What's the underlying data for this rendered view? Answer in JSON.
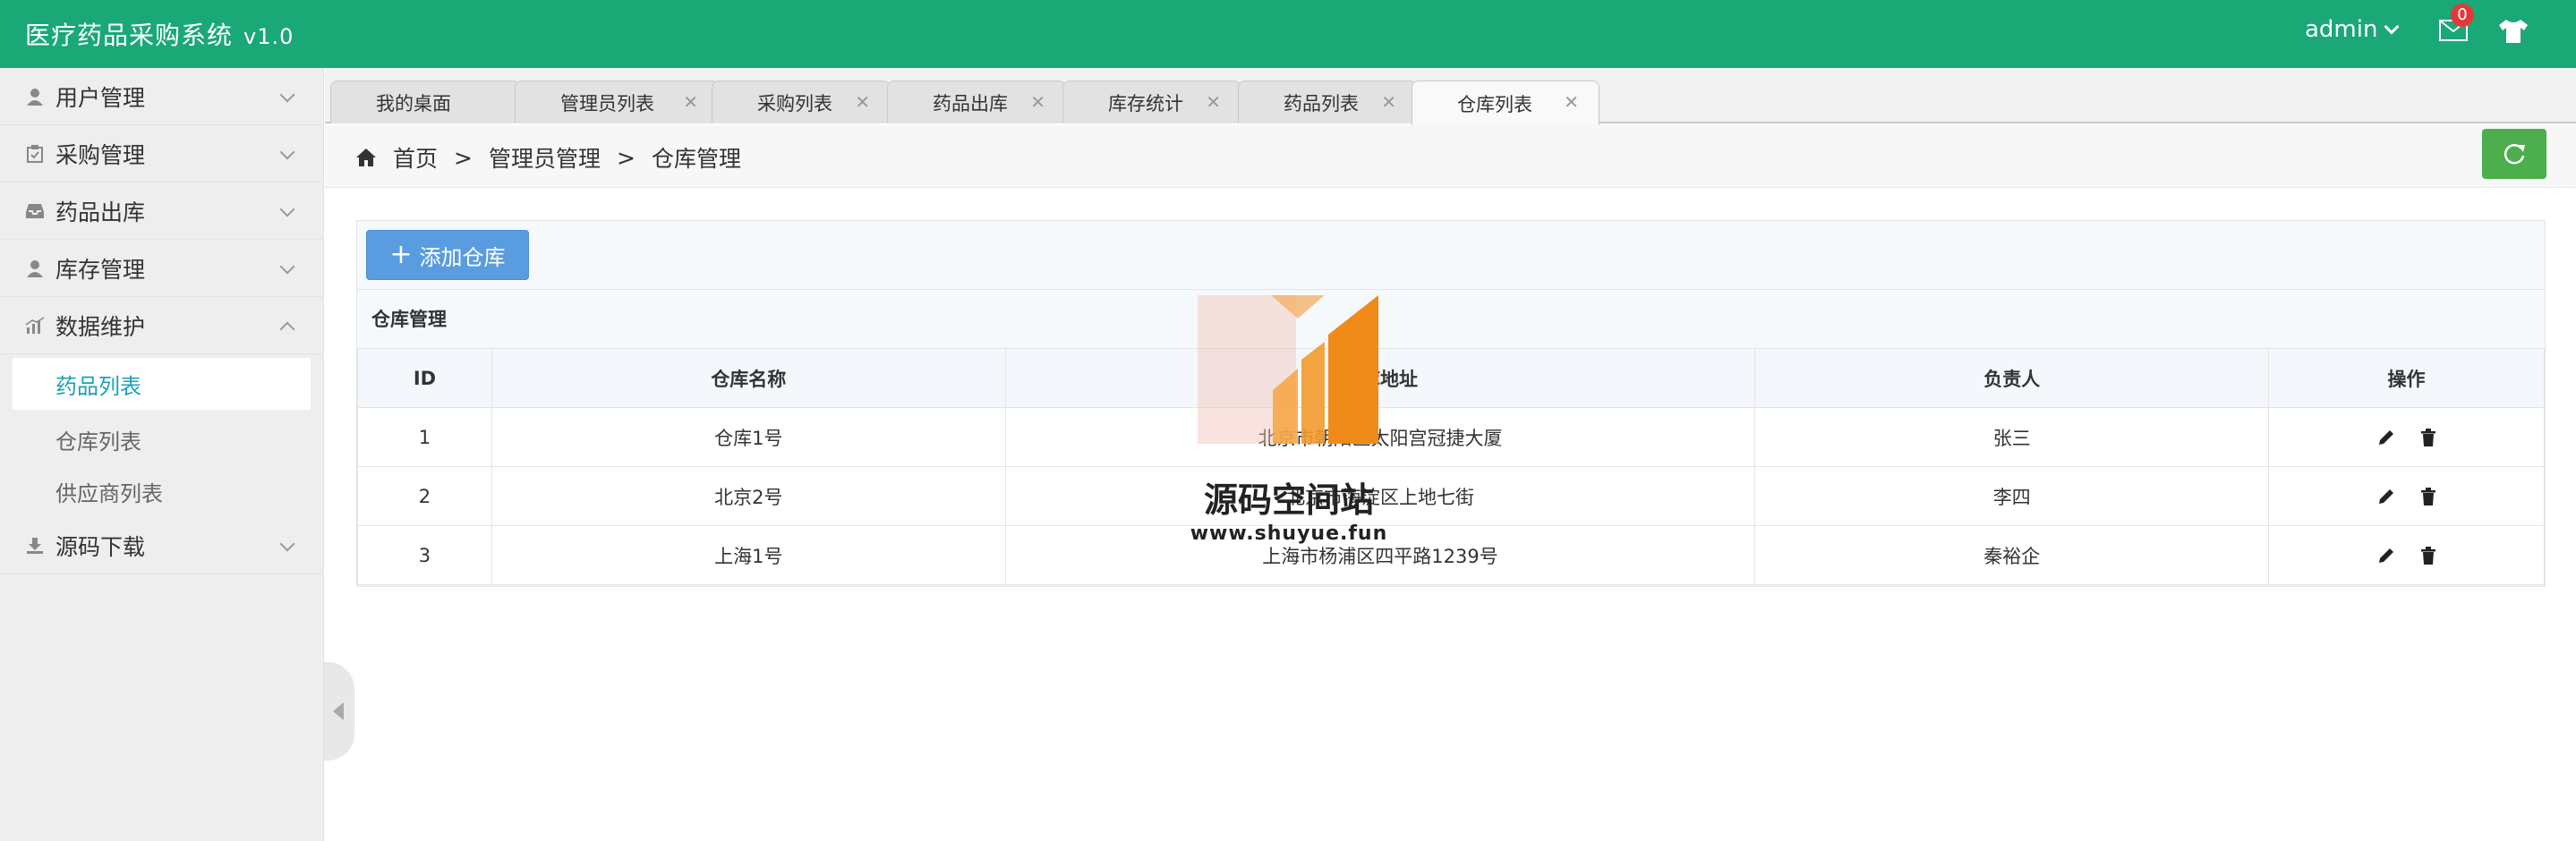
{
  "header": {
    "title": "医疗药品采购系统",
    "version": "v1.0",
    "user": "admin",
    "mail_count": "0",
    "brand_color": "#1aa876"
  },
  "sidebar": {
    "items": [
      {
        "label": "用户管理",
        "icon": "user-icon"
      },
      {
        "label": "采购管理",
        "icon": "clipboard-icon"
      },
      {
        "label": "药品出库",
        "icon": "inbox-icon"
      },
      {
        "label": "库存管理",
        "icon": "user-icon"
      },
      {
        "label": "数据维护",
        "icon": "bar-chart-icon"
      },
      {
        "label": "源码下载",
        "icon": "download-icon"
      }
    ],
    "sub_items": [
      {
        "label": "药品列表",
        "active": true
      },
      {
        "label": "仓库列表",
        "active": false
      },
      {
        "label": "供应商列表",
        "active": false
      }
    ]
  },
  "tabs": [
    {
      "label": "我的桌面",
      "closable": false
    },
    {
      "label": "管理员列表",
      "closable": true
    },
    {
      "label": "采购列表",
      "closable": true
    },
    {
      "label": "药品出库",
      "closable": true
    },
    {
      "label": "库存统计",
      "closable": true
    },
    {
      "label": "药品列表",
      "closable": true
    },
    {
      "label": "仓库列表",
      "closable": true,
      "active": true
    }
  ],
  "breadcrumb": [
    "首页",
    ">",
    "管理员管理",
    ">",
    "仓库管理"
  ],
  "main": {
    "add_button": "添加仓库",
    "panel_title": "仓库管理",
    "columns": [
      "ID",
      "仓库名称",
      "仓库地址",
      "负责人",
      "操作"
    ],
    "rows": [
      {
        "id": "1",
        "name": "仓库1号",
        "address": "北京市朝阳区太阳宫冠捷大厦",
        "manager": "张三"
      },
      {
        "id": "2",
        "name": "北京2号",
        "address": "北京市海淀区上地七街",
        "manager": "李四"
      },
      {
        "id": "3",
        "name": "上海1号",
        "address": "上海市杨浦区四平路1239号",
        "manager": "秦裕企"
      }
    ]
  },
  "watermark": {
    "title": "源码空间站",
    "url": "www.shuyue.fun"
  }
}
